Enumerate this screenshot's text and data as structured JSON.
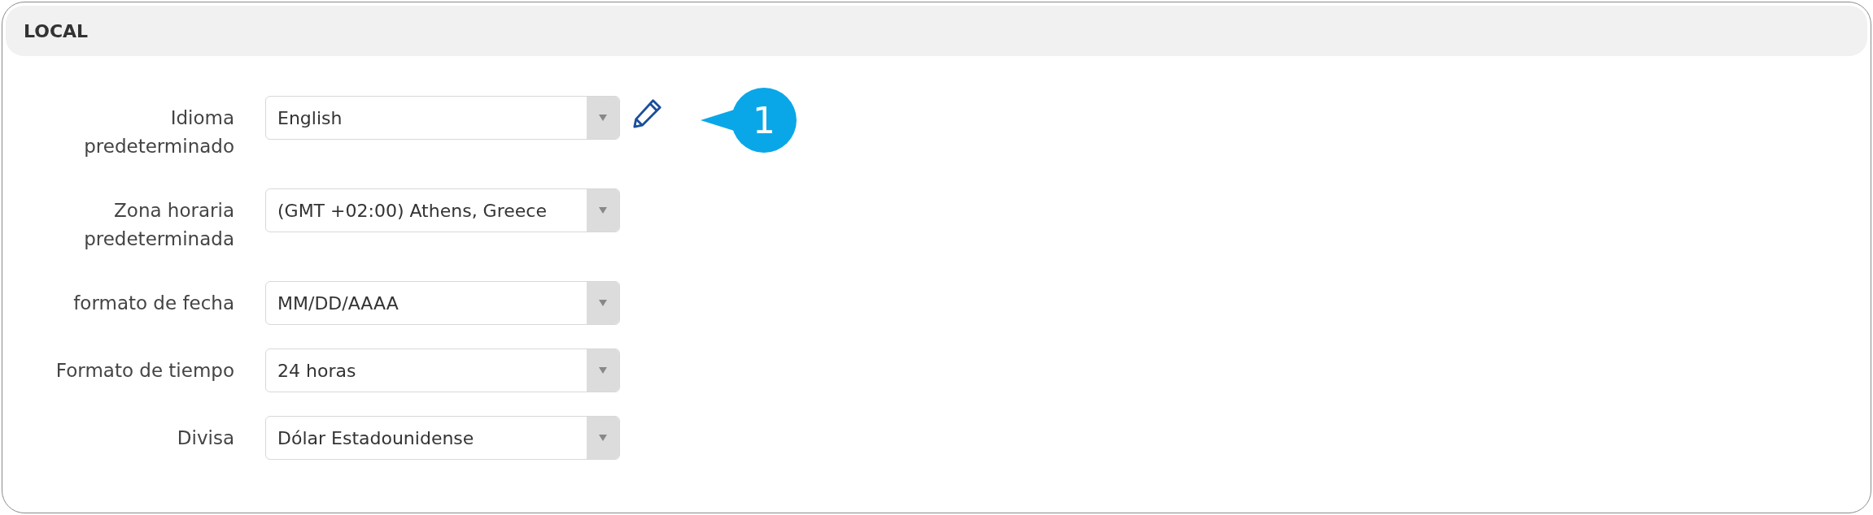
{
  "panel": {
    "title": "LOCAL"
  },
  "fields": [
    {
      "label": "Idioma predeterminado",
      "value": "English",
      "editable": true,
      "callout": "1"
    },
    {
      "label": "Zona horaria predeterminada",
      "value": "(GMT +02:00) Athens, Greece",
      "editable": false
    },
    {
      "label": "formato de fecha",
      "value": "MM/DD/AAAA",
      "editable": false
    },
    {
      "label": "Formato de tiempo",
      "value": "24 horas",
      "editable": false
    },
    {
      "label": "Divisa",
      "value": "Dólar Estadounidense",
      "editable": false
    }
  ]
}
